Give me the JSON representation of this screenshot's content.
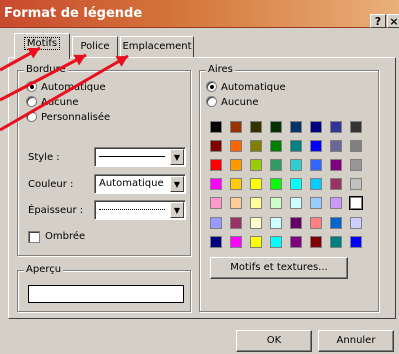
{
  "window": {
    "title": "Format de légende",
    "help_label": "?",
    "close_label": "×"
  },
  "tabs": [
    {
      "label": "Motifs",
      "active": true
    },
    {
      "label": "Police",
      "active": false
    },
    {
      "label": "Emplacement",
      "active": false
    }
  ],
  "bordure": {
    "legend": "Bordure",
    "options": [
      {
        "label": "Automatique",
        "selected": true
      },
      {
        "label": "Aucune",
        "selected": false
      },
      {
        "label": "Personnalisée",
        "selected": false
      }
    ],
    "style_label": "Style :",
    "couleur_label": "Couleur :",
    "couleur_value": "Automatique",
    "epaisseur_label": "Épaisseur :",
    "ombree_label": "Ombrée",
    "ombree_checked": false
  },
  "apercu": {
    "legend": "Aperçu"
  },
  "aires": {
    "legend": "Aires",
    "options": [
      {
        "label": "Automatique",
        "selected": true
      },
      {
        "label": "Aucune",
        "selected": false
      }
    ],
    "palette_main": [
      [
        "#000000",
        "#993300",
        "#333300",
        "#003300",
        "#003366",
        "#000080",
        "#333399",
        "#333333"
      ],
      [
        "#800000",
        "#ff6600",
        "#808000",
        "#008000",
        "#008080",
        "#0000ff",
        "#666699",
        "#808080"
      ],
      [
        "#ff0000",
        "#ff9900",
        "#99cc00",
        "#339966",
        "#33cccc",
        "#3366ff",
        "#800080",
        "#969696"
      ],
      [
        "#ff00ff",
        "#ffcc00",
        "#ffff00",
        "#00ff00",
        "#00ffff",
        "#00ccff",
        "#993366",
        "#c0c0c0"
      ],
      [
        "#ff99cc",
        "#ffcc99",
        "#ffff99",
        "#ccffcc",
        "#ccffff",
        "#99ccff",
        "#cc99ff",
        "#ffffff"
      ]
    ],
    "palette_chart": [
      [
        "#9999ff",
        "#993366",
        "#ffffcc",
        "#ccffff",
        "#660066",
        "#ff8080",
        "#0066cc",
        "#ccccff"
      ],
      [
        "#000080",
        "#ff00ff",
        "#ffff00",
        "#00ffff",
        "#800080",
        "#800000",
        "#008080",
        "#0000ff"
      ]
    ],
    "selected_color": "#ffffff",
    "fill_button": "Motifs et textures..."
  },
  "buttons": {
    "ok": "OK",
    "cancel": "Annuler"
  },
  "annotation_color": "#e8101e"
}
